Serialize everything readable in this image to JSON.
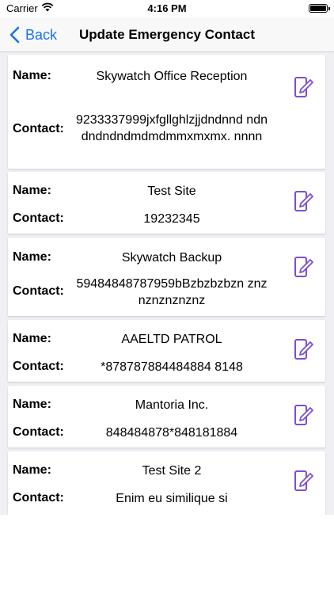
{
  "status": {
    "carrier": "Carrier",
    "time": "4:16 PM"
  },
  "nav": {
    "back_label": "Back",
    "title": "Update Emergency Contact"
  },
  "labels": {
    "name": "Name:",
    "contact": "Contact:"
  },
  "contacts": [
    {
      "name": "Skywatch Office Reception",
      "contact": "9233337999jxfgllghlzjjdndnnd ndndndndndmdmdmmxmxmx. nnnn"
    },
    {
      "name": "Test Site",
      "contact": "19232345"
    },
    {
      "name": "Skywatch Backup",
      "contact": "59484848787959bBzbzbzbzn znznznznznznz"
    },
    {
      "name": "AAELTD PATROL",
      "contact": "*878787884484884 8148"
    },
    {
      "name": "Mantoria Inc.",
      "contact": "848484878*848181884"
    },
    {
      "name": "Test Site 2",
      "contact": "Enim eu similique si"
    }
  ],
  "colors": {
    "accent": "#1a73e8",
    "edit_icon": "#7b4fd6"
  }
}
